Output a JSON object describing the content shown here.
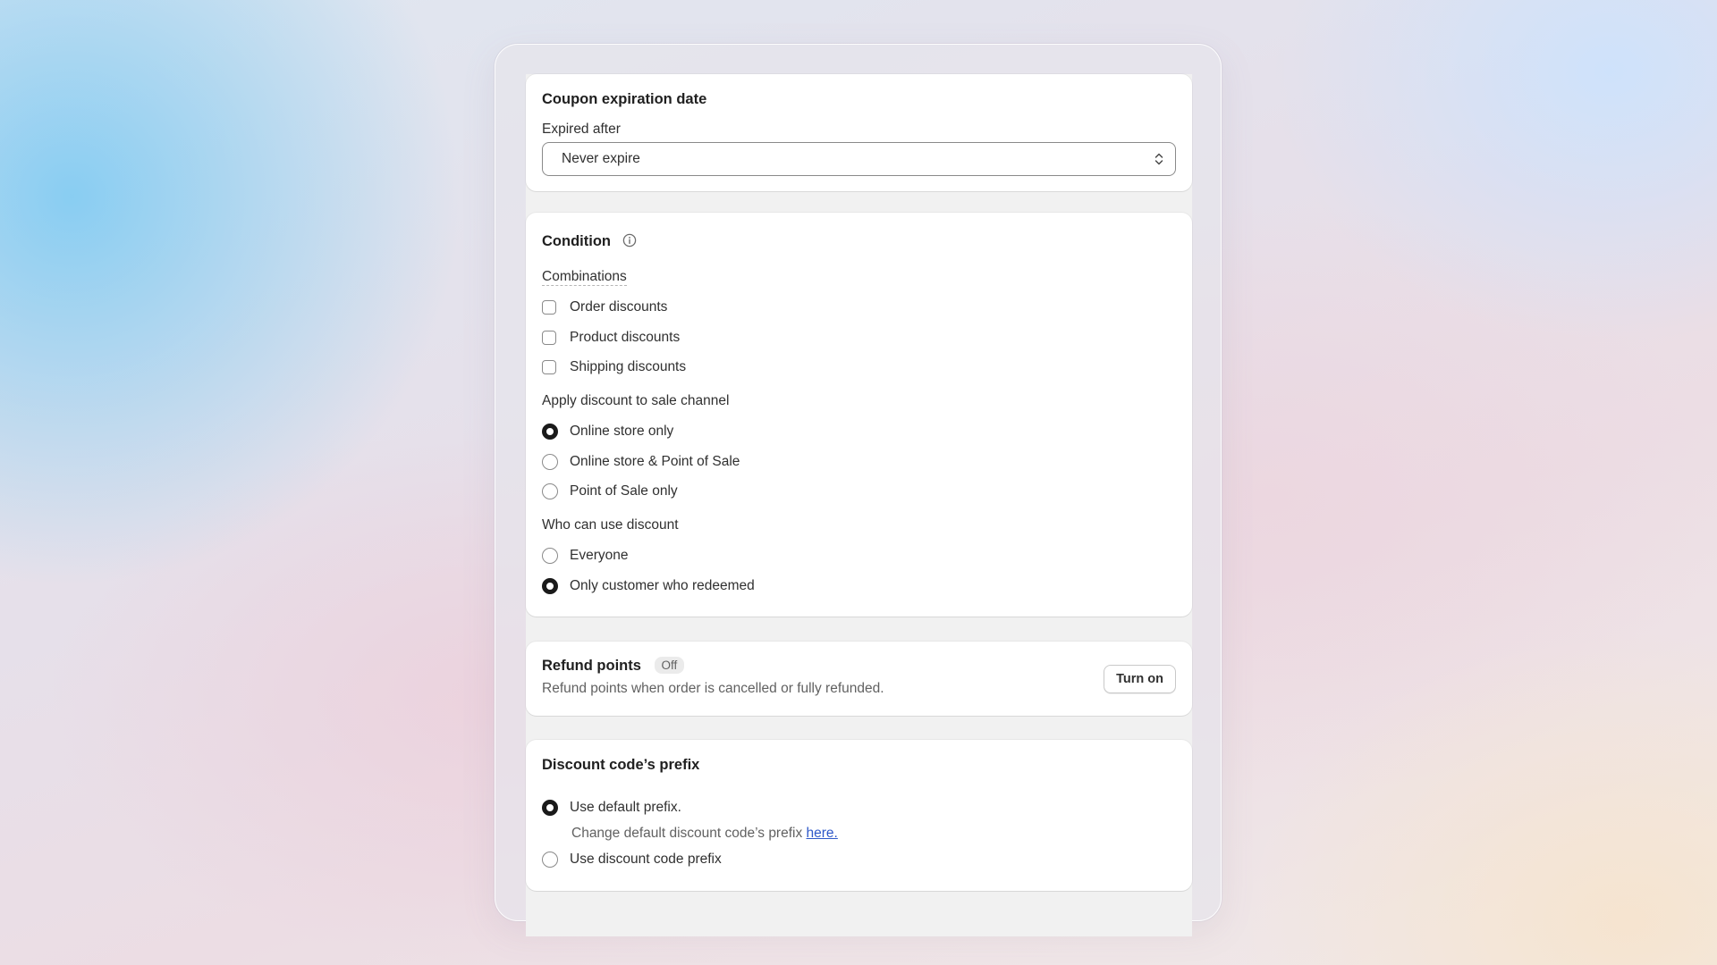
{
  "expiration": {
    "title": "Coupon expiration date",
    "field_label": "Expired after",
    "selected_value": "Never expire"
  },
  "condition": {
    "title": "Condition",
    "combinations": {
      "label": "Combinations",
      "options": [
        {
          "label": "Order discounts",
          "checked": false
        },
        {
          "label": "Product discounts",
          "checked": false
        },
        {
          "label": "Shipping discounts",
          "checked": false
        }
      ]
    },
    "sale_channel": {
      "label": "Apply discount to sale channel",
      "options": [
        {
          "label": "Online store only",
          "selected": true
        },
        {
          "label": "Online store & Point of Sale",
          "selected": false
        },
        {
          "label": "Point of Sale only",
          "selected": false
        }
      ]
    },
    "who_can_use": {
      "label": "Who can use discount",
      "options": [
        {
          "label": "Everyone",
          "selected": false
        },
        {
          "label": "Only customer who redeemed",
          "selected": true
        }
      ]
    }
  },
  "refund": {
    "title": "Refund points",
    "status_badge": "Off",
    "description": "Refund points when order is cancelled or fully refunded.",
    "button_label": "Turn on"
  },
  "prefix": {
    "title": "Discount code’s prefix",
    "options": [
      {
        "label": "Use default prefix.",
        "selected": true
      },
      {
        "label": "Use discount code prefix",
        "selected": false
      }
    ],
    "hint_text": "Change default discount code’s prefix ",
    "hint_link": "here."
  }
}
